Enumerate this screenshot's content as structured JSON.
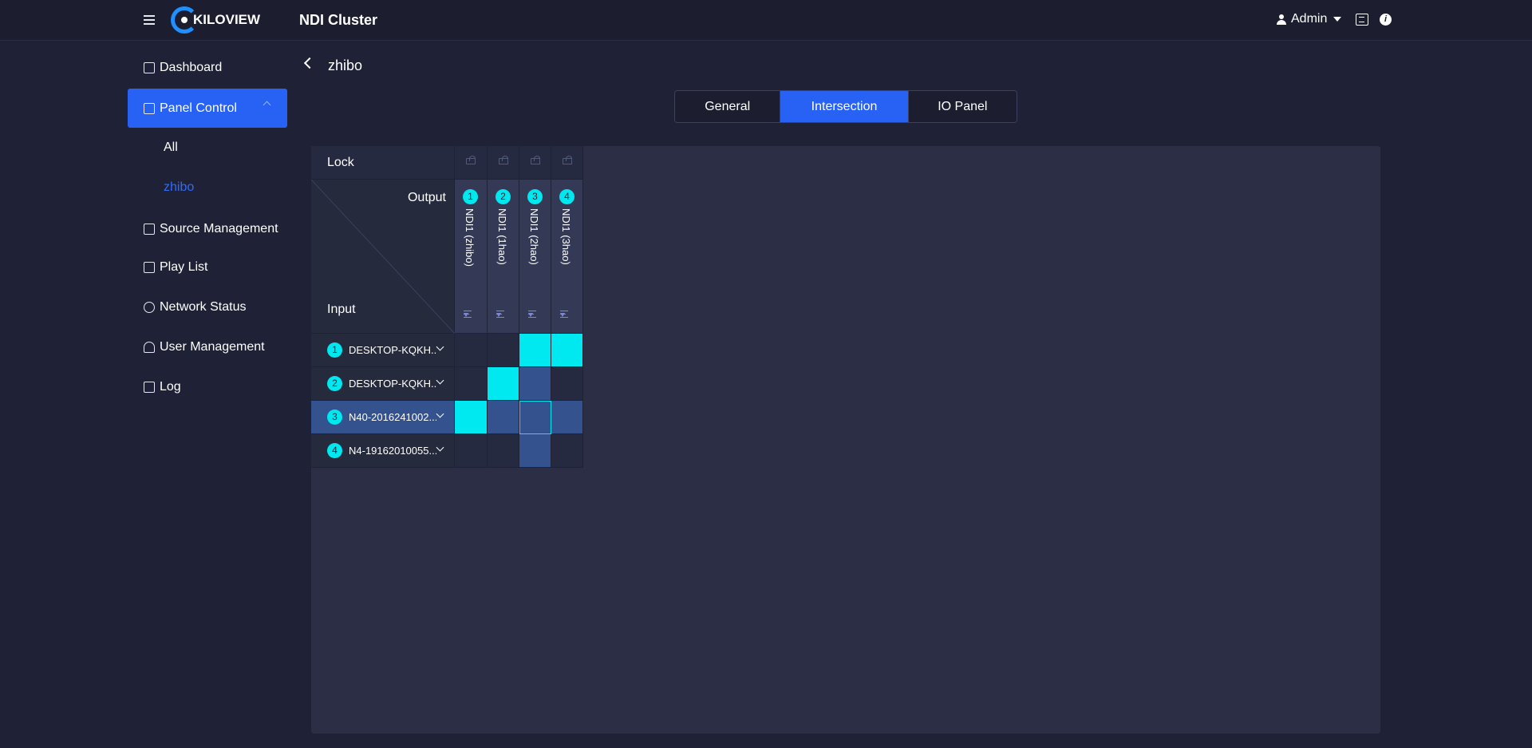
{
  "header": {
    "logo_text": "KILOVIEW",
    "app_title": "NDI Cluster",
    "user": "Admin"
  },
  "sidebar": {
    "items": [
      {
        "label": "Dashboard",
        "icon": "dashboard-icon"
      },
      {
        "label": "Panel Control",
        "icon": "panel-icon",
        "active": true
      },
      {
        "label": "Source Management",
        "icon": "ndi-icon"
      },
      {
        "label": "Play List",
        "icon": "playlist-icon"
      },
      {
        "label": "Network Status",
        "icon": "globe-icon"
      },
      {
        "label": "User Management",
        "icon": "user-icon"
      },
      {
        "label": "Log",
        "icon": "log-icon"
      }
    ],
    "sub_items": [
      {
        "label": "All"
      },
      {
        "label": "zhibo",
        "selected": true
      }
    ]
  },
  "breadcrumb": {
    "title": "zhibo"
  },
  "tabs": [
    {
      "label": "General"
    },
    {
      "label": "Intersection",
      "active": true
    },
    {
      "label": "IO Panel"
    }
  ],
  "matrix": {
    "lock_label": "Lock",
    "output_label": "Output",
    "input_label": "Input",
    "outputs": [
      {
        "num": "1",
        "name": "NDI1 (zhibo)"
      },
      {
        "num": "2",
        "name": "NDI1 (1hao)"
      },
      {
        "num": "3",
        "name": "NDI1 (2hao)"
      },
      {
        "num": "4",
        "name": "NDI1 (3hao)"
      }
    ],
    "inputs": [
      {
        "num": "1",
        "name": "DESKTOP-KQKH..."
      },
      {
        "num": "2",
        "name": "DESKTOP-KQKH..."
      },
      {
        "num": "3",
        "name": "N40-2016241002...",
        "selected": true
      },
      {
        "num": "4",
        "name": "N4-19162010055..."
      }
    ],
    "connections": [
      [
        false,
        false,
        true,
        true
      ],
      [
        false,
        true,
        false,
        false
      ],
      [
        true,
        false,
        false,
        false
      ],
      [
        false,
        false,
        false,
        false
      ]
    ],
    "selected_cell": [
      2,
      2
    ]
  },
  "colors": {
    "accent": "#2762f5",
    "cyan": "#00e8f0",
    "highlight": "#33528e"
  }
}
